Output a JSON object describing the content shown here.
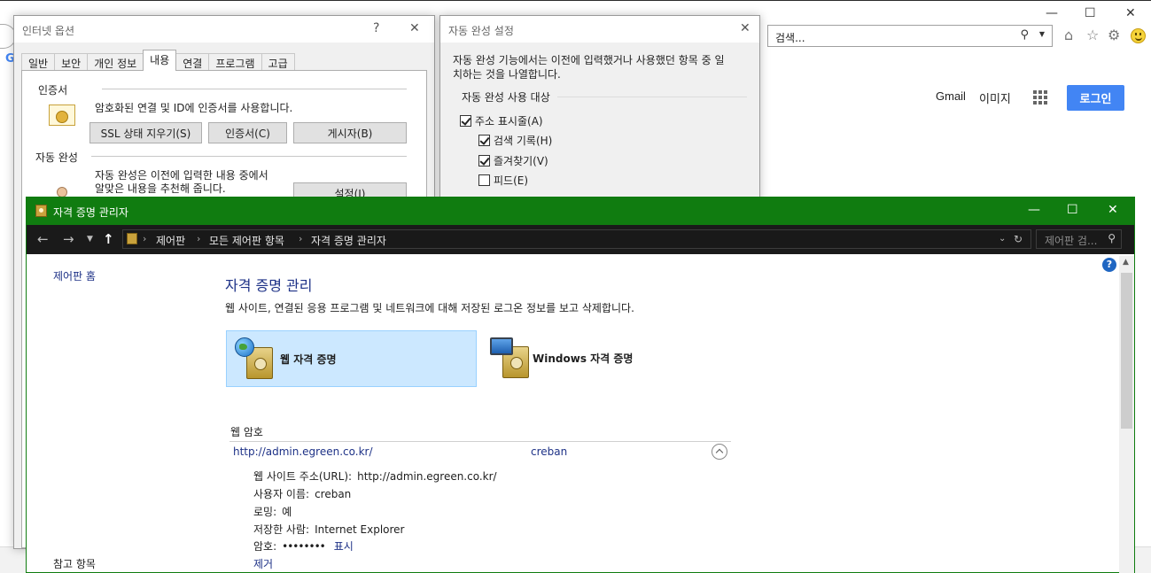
{
  "browser": {
    "search_placeholder": "검색...",
    "gmail": "Gmail",
    "images": "이미지",
    "login": "로그인"
  },
  "internet_options": {
    "title": "인터넷 옵션",
    "help_glyph": "?",
    "tabs": [
      "일반",
      "보안",
      "개인 정보",
      "내용",
      "연결",
      "프로그램",
      "고급"
    ],
    "active_tab_index": 3,
    "certificates": {
      "label": "인증서",
      "description": "암호화된 연결 및 ID에 인증서를 사용합니다.",
      "buttons": [
        "SSL 상태 지우기(S)",
        "인증서(C)",
        "게시자(B)"
      ]
    },
    "autocomplete": {
      "label": "자동 완성",
      "description_line1": "자동 완성은 이전에 입력한 내용 중에서",
      "description_line2": "알맞은 내용을 추천해 줍니다.",
      "settings_button": "설정(I)"
    }
  },
  "autocomplete_settings": {
    "title": "자동 완성 설정",
    "description_line1": "자동 완성 기능에서는 이전에 입력했거나 사용했던 항목 중 일",
    "description_line2": "치하는 것을 나열합니다.",
    "group_label": "자동 완성 사용 대상",
    "options": [
      {
        "label": "주소 표시줄(A)",
        "checked": true
      },
      {
        "label": "검색 기록(H)",
        "checked": true
      },
      {
        "label": "즐겨찾기(V)",
        "checked": true
      },
      {
        "label": "피드(E)",
        "checked": false
      }
    ]
  },
  "credential_manager": {
    "title": "자격 증명 관리자",
    "breadcrumb": [
      "제어판",
      "모든 제어판 항목",
      "자격 증명 관리자"
    ],
    "search_placeholder": "제어판 검...",
    "left_nav": {
      "home": "제어판 홈",
      "see_also": "참고 항목"
    },
    "heading": "자격 증명 관리",
    "description": "웹 사이트, 연결된 응용 프로그램 및 네트워크에 대해 저장된 로그온 정보를 보고 삭제합니다.",
    "tiles": [
      {
        "label": "웹 자격 증명",
        "selected": true
      },
      {
        "label": "Windows 자격 증명",
        "selected": false
      }
    ],
    "section_title": "웹 암호",
    "credential": {
      "url": "http://admin.egreen.co.kr/",
      "user": "creban",
      "details": {
        "site_label": "웹 사이트 주소(URL):",
        "site_value": "http://admin.egreen.co.kr/",
        "user_label": "사용자 이름:",
        "user_value": "creban",
        "roaming_label": "로밍:",
        "roaming_value": "예",
        "saved_by_label": "저장한 사람:",
        "saved_by_value": "Internet Explorer",
        "password_label": "암호:",
        "password_value": "••••••••",
        "show_link": "표시",
        "remove_link": "제거"
      }
    }
  },
  "colors": {
    "cm_title_bar": "#107c10",
    "cm_nav_bar": "#1a1a1a",
    "selected_tile": "#cce8ff",
    "link": "#1e3287",
    "google_login": "#4285f4"
  },
  "icons": [
    "home-icon",
    "star-icon",
    "gear-icon",
    "smiley-icon",
    "search-icon",
    "back-arrow-icon",
    "forward-arrow-icon",
    "up-arrow-icon",
    "refresh-icon",
    "help-icon",
    "vault-icon",
    "globe-icon",
    "monitor-icon",
    "certificate-icon",
    "user-icon",
    "apps-grid-icon"
  ]
}
